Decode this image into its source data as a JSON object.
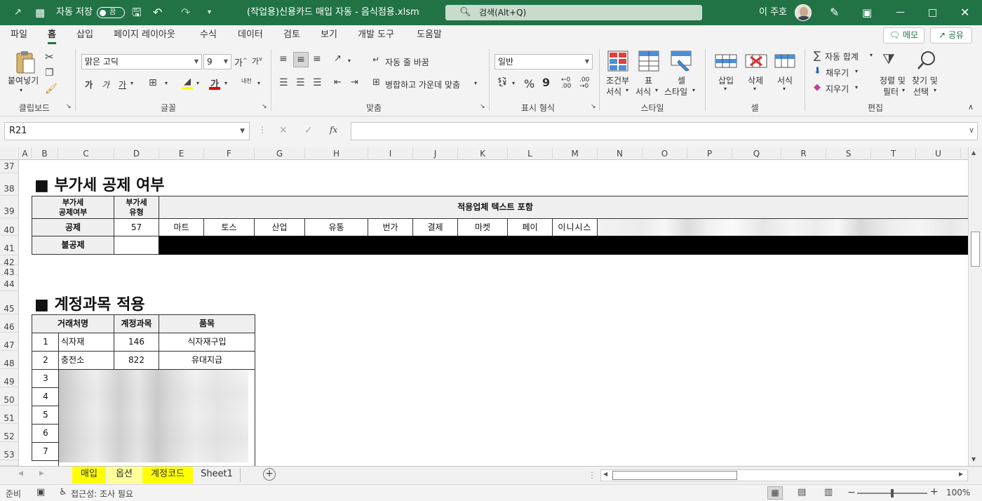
{
  "titlebar": {
    "autosave_label": "자동 저장",
    "autosave_state": "끔",
    "file_title": "(작업용)신용카드 매입 자동 - 음식점용.xlsm",
    "search_placeholder": "검색(Alt+Q)",
    "user_name": "이 주호"
  },
  "menu": {
    "items": [
      "파일",
      "홈",
      "삽입",
      "페이지 레이아웃",
      "수식",
      "데이터",
      "검토",
      "보기",
      "개발 도구",
      "도움말"
    ],
    "active": "홈",
    "memo_label": "메모",
    "share_label": "공유"
  },
  "ribbon": {
    "clipboard": {
      "paste_label": "붙여넣기",
      "group_label": "클립보드"
    },
    "font": {
      "font_name": "맑은 고딕",
      "font_size": "9",
      "group_label": "글꼴",
      "bold": "가",
      "italic": "가",
      "underline": "가",
      "font_color_glyph": "가",
      "inc_size": "가",
      "dec_size": "가",
      "phonetic": "내천"
    },
    "alignment": {
      "wrap_label": "자동 줄 바꿈",
      "merge_label": "병합하고 가운데 맞춤",
      "group_label": "맞춤"
    },
    "number": {
      "format": "일반",
      "group_label": "표시 형식",
      "percent": "%",
      "comma": "9"
    },
    "styles": {
      "conditional_label_1": "조건부",
      "conditional_label_2": "서식",
      "table_label_1": "표",
      "table_label_2": "서식",
      "cell_style_label_1": "셀",
      "cell_style_label_2": "스타일",
      "group_label": "스타일"
    },
    "cells": {
      "insert_label": "삽입",
      "delete_label": "삭제",
      "format_label": "서식",
      "group_label": "셀"
    },
    "editing": {
      "autosum_label": "자동 합계",
      "fill_label": "채우기",
      "clear_label": "지우기",
      "sort_label_1": "정렬 및",
      "sort_label_2": "필터",
      "find_label_1": "찾기 및",
      "find_label_2": "선택",
      "group_label": "편집"
    }
  },
  "formula_bar": {
    "name_box": "R21",
    "formula": "",
    "fx": "fx"
  },
  "columns": [
    "A",
    "B",
    "C",
    "D",
    "E",
    "F",
    "G",
    "H",
    "I",
    "J",
    "K",
    "L",
    "M",
    "N",
    "O",
    "P",
    "Q",
    "R",
    "S",
    "T",
    "U"
  ],
  "rows": [
    "37",
    "38",
    "39",
    "40",
    "41",
    "42",
    "43",
    "44",
    "45",
    "46",
    "47",
    "48",
    "49",
    "50",
    "51",
    "52",
    "53"
  ],
  "section1": {
    "title": "■ 부가세 공제 여부",
    "hdr_deduct": "부가세\n공제여부",
    "hdr_type": "부가세\n유형",
    "hdr_text": "적용업체 텍스트 포함",
    "row_deduct_label": "공제",
    "row_deduct_type": "57",
    "keywords": [
      "마트",
      "토스",
      "산업",
      "유통",
      "번가",
      "결제",
      "마켓",
      "페이",
      "이니시스"
    ],
    "row_nondeduct_label": "불공제"
  },
  "section2": {
    "title": "■ 계정과목 적용",
    "headers": [
      "거래처명",
      "계정과목",
      "품목"
    ],
    "rows": [
      {
        "no": "1",
        "vendor": "식자재",
        "account": "146",
        "item": "식자재구입"
      },
      {
        "no": "2",
        "vendor": "충전소",
        "account": "822",
        "item": "유대지급"
      },
      {
        "no": "3"
      },
      {
        "no": "4"
      },
      {
        "no": "5"
      },
      {
        "no": "6"
      },
      {
        "no": "7"
      }
    ]
  },
  "sheet_tabs": [
    {
      "label": "매입",
      "color": "#ffff00"
    },
    {
      "label": "옵션",
      "color": "#ffff99"
    },
    {
      "label": "계정코드",
      "color": "#ffff00"
    },
    {
      "label": "Sheet1",
      "color": ""
    }
  ],
  "status": {
    "ready": "준비",
    "accessibility": "접근성: 조사 필요",
    "zoom": "100%"
  }
}
